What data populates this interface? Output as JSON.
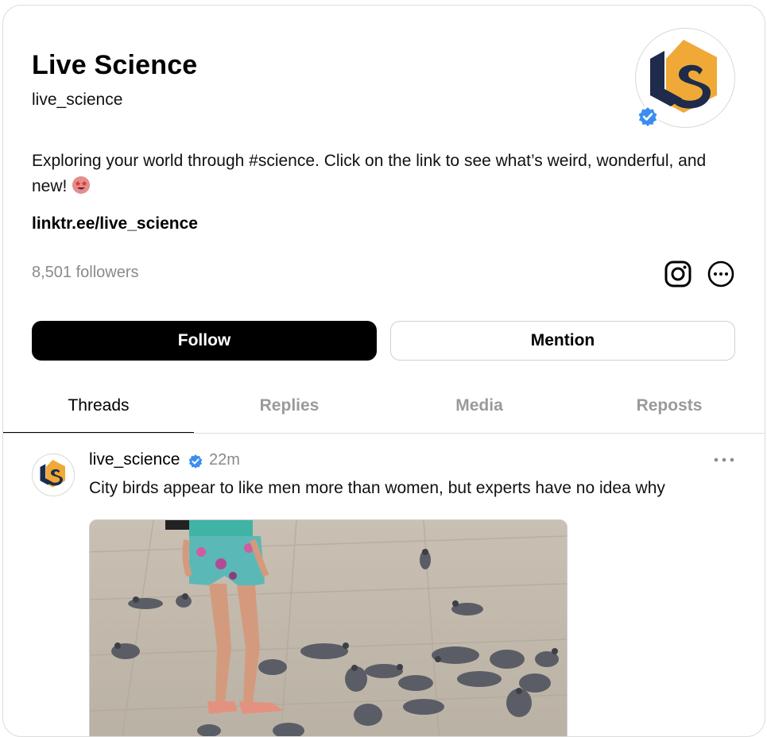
{
  "profile": {
    "name": "Live Science",
    "handle": "live_science",
    "bio": "Exploring your world through #science. Click on the link to see what’s weird, wonderful, and new!",
    "bio_emoji": "star-struck-emoji",
    "link": "linktr.ee/live_science",
    "followers": "8,501 followers"
  },
  "icons": {
    "instagram": "instagram-icon",
    "more": "more-options-icon",
    "verified": "verified-badge-icon"
  },
  "actions": {
    "follow_label": "Follow",
    "mention_label": "Mention"
  },
  "tabs": [
    {
      "label": "Threads",
      "active": true
    },
    {
      "label": "Replies",
      "active": false
    },
    {
      "label": "Media",
      "active": false
    },
    {
      "label": "Reposts",
      "active": false
    }
  ],
  "post": {
    "username": "live_science",
    "time": "22m",
    "text": "City birds appear to like men more than women, but experts have no idea why",
    "image": "photo of pigeons on pavement near a person in shorts and sandals"
  },
  "colors": {
    "brand_orange": "#f0a936",
    "brand_navy": "#1e2b4a",
    "verified_blue": "#3b8ef0"
  }
}
